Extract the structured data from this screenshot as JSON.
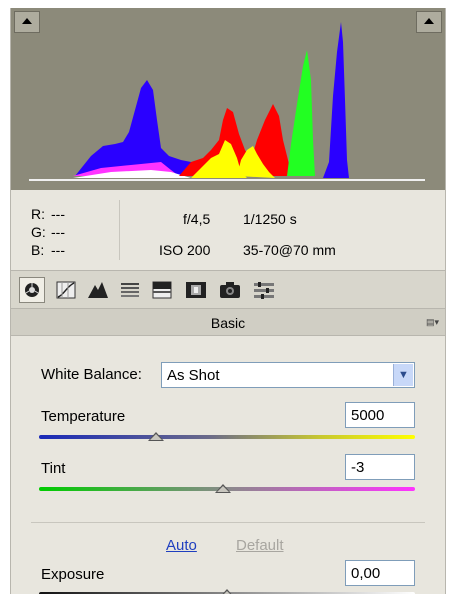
{
  "histogram": {
    "clip_left_icon": "shadow-clipping-triangle",
    "clip_right_icon": "highlight-clipping-triangle",
    "colors": {
      "background": "#8c8a7a",
      "blue": "#2a00ff",
      "red": "#ff0000",
      "green": "#22ff22",
      "yellow": "#ffff00",
      "magenta": "#ff33ff",
      "white": "#ffffff"
    }
  },
  "info": {
    "r_label": "R:",
    "r_value": "---",
    "g_label": "G:",
    "g_value": "---",
    "b_label": "B:",
    "b_value": "---",
    "aperture": "f/4,5",
    "shutter": "1/1250 s",
    "iso": "ISO 200",
    "lens": "35-70@70 mm"
  },
  "tabs": [
    {
      "name": "basic",
      "icon": "aperture-icon",
      "active": true
    },
    {
      "name": "tone-curve",
      "icon": "tone-curve-icon"
    },
    {
      "name": "detail",
      "icon": "detail-icon"
    },
    {
      "name": "hsl",
      "icon": "hsl-grayscale-icon"
    },
    {
      "name": "split-toning",
      "icon": "split-toning-icon"
    },
    {
      "name": "lens-corrections",
      "icon": "lens-corrections-icon"
    },
    {
      "name": "camera-calibration",
      "icon": "camera-icon"
    },
    {
      "name": "presets",
      "icon": "presets-icon"
    }
  ],
  "panel_title": "Basic",
  "white_balance": {
    "label": "White Balance:",
    "value": "As Shot"
  },
  "temperature": {
    "label": "Temperature",
    "value": "5000",
    "level": 0.31
  },
  "tint": {
    "label": "Tint",
    "value": "-3",
    "level": 0.49
  },
  "auto_label": "Auto",
  "default_label": "Default",
  "exposure": {
    "label": "Exposure",
    "value": "0,00",
    "level": 0.5
  }
}
